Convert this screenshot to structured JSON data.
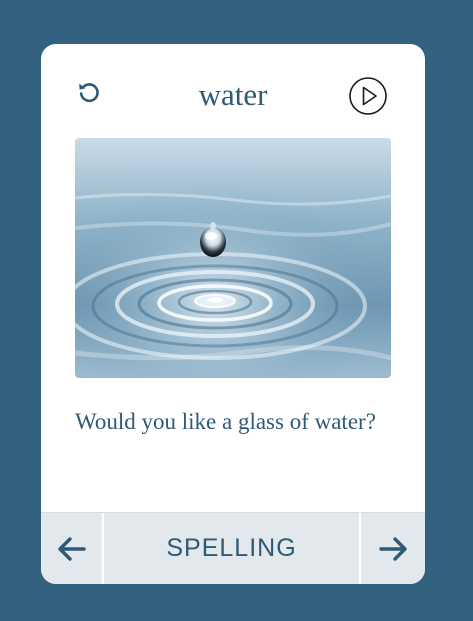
{
  "card": {
    "word": "water",
    "sentence": "Would you like a glass of water?",
    "image_subject": "water droplet splash"
  },
  "icons": {
    "reset": "reset-icon",
    "play": "play-icon",
    "previous": "arrow-left-icon",
    "next": "arrow-right-icon"
  },
  "footer": {
    "mode_label": "SPELLING"
  },
  "colors": {
    "page_background": "#336180",
    "card_background": "#ffffff",
    "text": "#2f5a76",
    "footer_background": "#e2e8ec"
  }
}
